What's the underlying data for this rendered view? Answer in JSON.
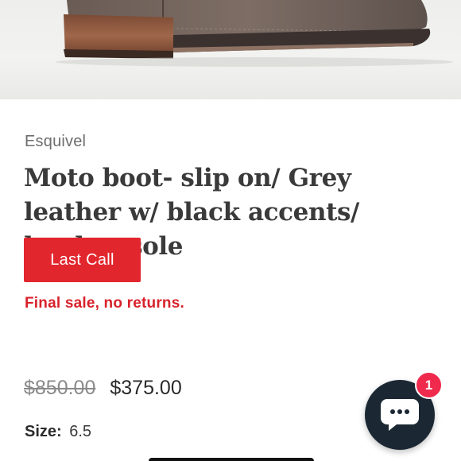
{
  "product": {
    "image_alt": "Grey leather moto boot, side view",
    "brand": "Esquivel",
    "title": "Moto boot- slip on/ Grey leather w/ black accents/ leather sole",
    "badge": "Last Call",
    "final_sale_note": "Final sale, no returns.",
    "price_original": "$850.00",
    "price_sale": "$375.00",
    "size_label": "Size:",
    "size_value": "6.5"
  },
  "chat": {
    "icon": "chat-bubble-icon",
    "unread_count": "1"
  },
  "colors": {
    "badge_bg": "#e2262e",
    "sale_text": "#d8222b",
    "chat_bg": "#1b2833",
    "chat_badge": "#ef2a4d"
  }
}
